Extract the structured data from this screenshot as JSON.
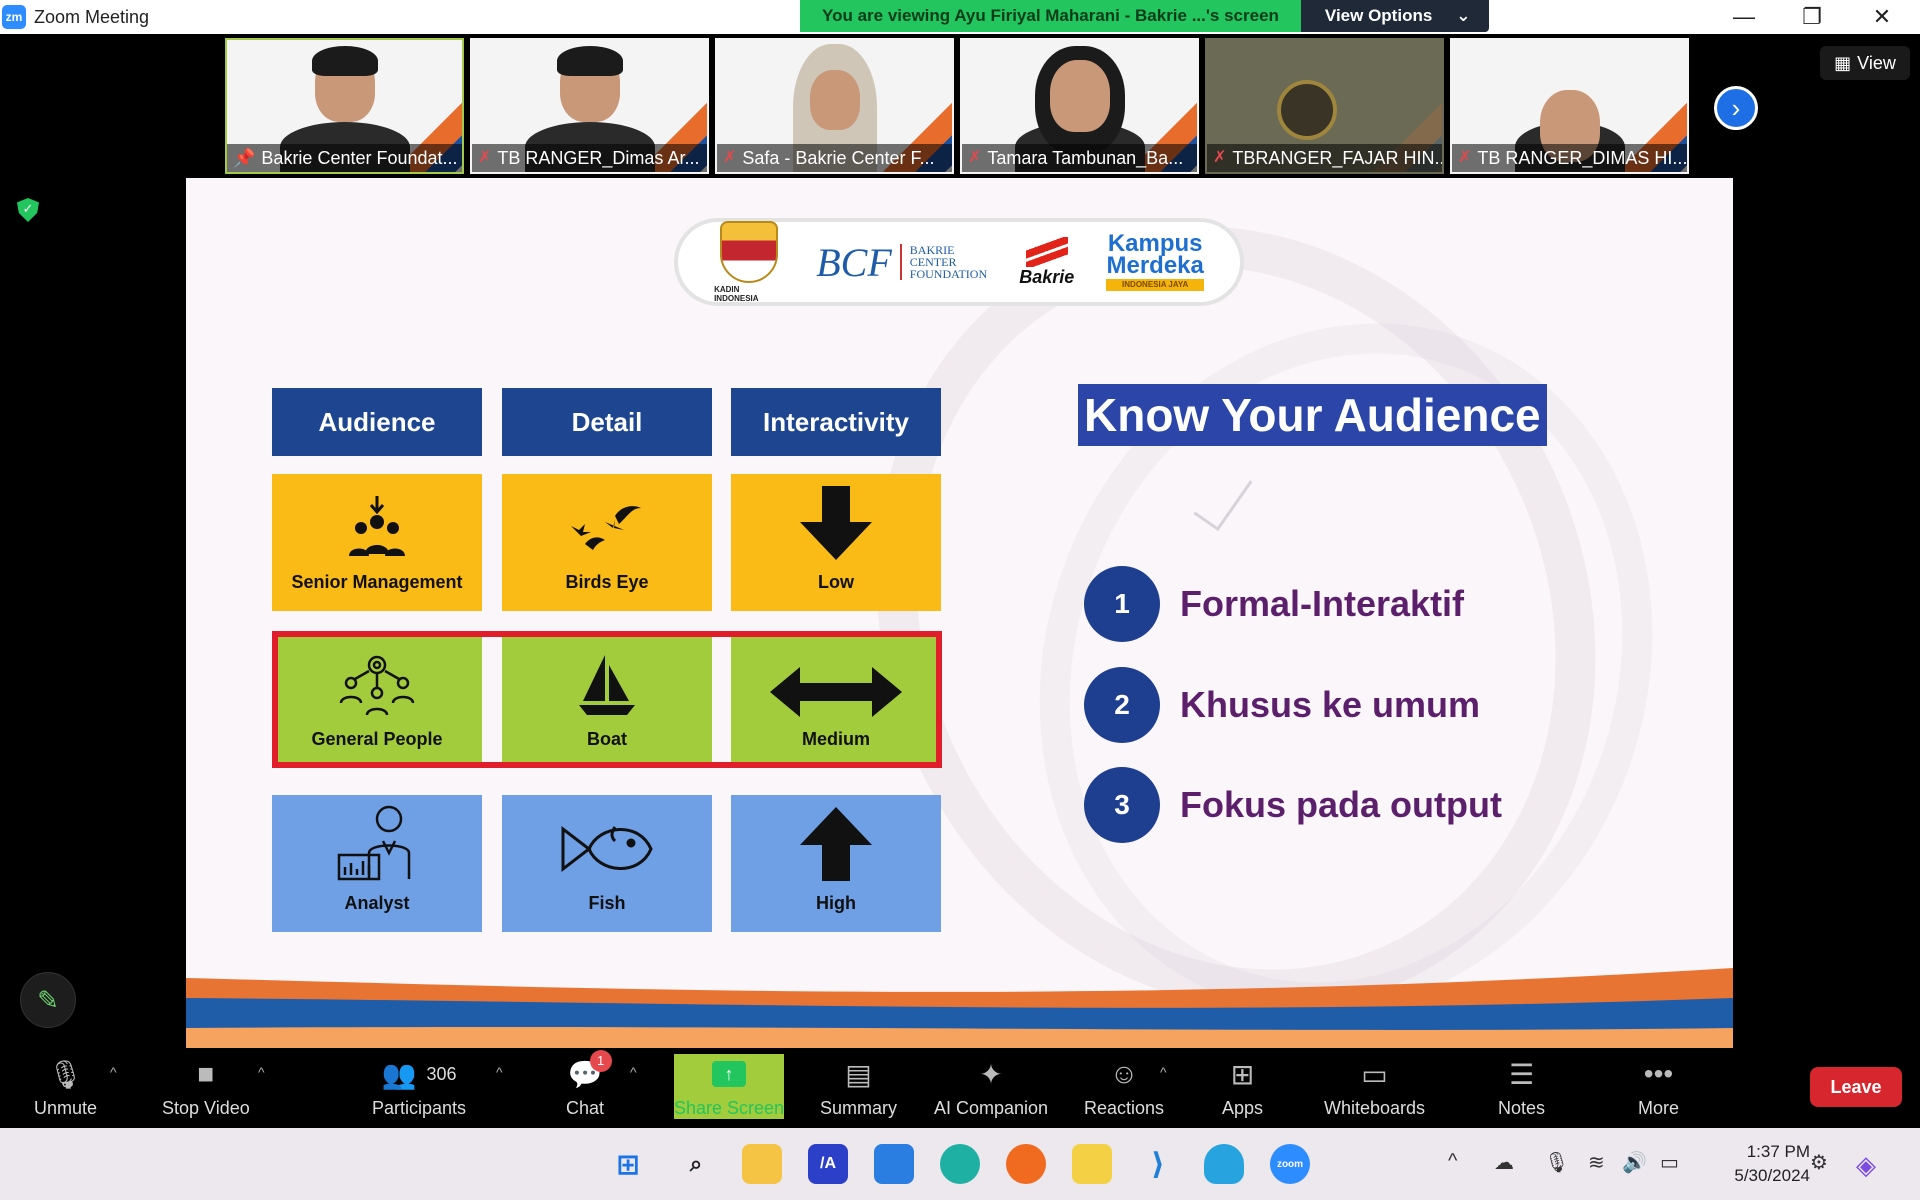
{
  "window": {
    "logo": "zm",
    "title": "Zoom Meeting",
    "minimize_icon": "minimize-icon",
    "restore_icon": "restore-icon",
    "close_icon": "close-icon"
  },
  "share_banner": {
    "message": "You are viewing Ayu Firiyal Maharani - Bakrie ...'s screen",
    "view_options": "View Options"
  },
  "participants_strip": [
    {
      "name": "Bakrie Center Foundat...",
      "muted": false
    },
    {
      "name": "TB RANGER_Dimas Ar...",
      "muted": true
    },
    {
      "name": "Safa - Bakrie Center F...",
      "muted": true
    },
    {
      "name": "Tamara Tambunan_Ba...",
      "muted": true
    },
    {
      "name": "TBRANGER_FAJAR HIN...",
      "muted": true
    },
    {
      "name": "TB RANGER_DIMAS HI...",
      "muted": true
    }
  ],
  "view_button": "View",
  "slide": {
    "logos": {
      "kadin": "KADIN INDONESIA",
      "bcf_mono": "BCF",
      "bcf_text": [
        "BAKRIE",
        "CENTER",
        "FOUNDATION"
      ],
      "bakrie": "Bakrie",
      "kampus_merdeka": [
        "Kampus",
        "Merdeka"
      ],
      "kampus_merdeka_sub": "INDONESIA JAYA"
    },
    "headers": [
      "Audience",
      "Detail",
      "Interactivity"
    ],
    "rows": [
      {
        "color": "#fbbb16",
        "cells": [
          {
            "label": "Senior Management",
            "icon": "senior-management-icon"
          },
          {
            "label": "Birds Eye",
            "icon": "birds-icon"
          },
          {
            "label": "Low",
            "icon": "arrow-down-icon"
          }
        ]
      },
      {
        "color": "#a3cc3c",
        "cells": [
          {
            "label": "General People",
            "icon": "general-people-icon"
          },
          {
            "label": "Boat",
            "icon": "boat-icon"
          },
          {
            "label": "Medium",
            "icon": "arrow-left-right-icon"
          }
        ]
      },
      {
        "color": "#6f9fe4",
        "cells": [
          {
            "label": "Analyst",
            "icon": "analyst-icon"
          },
          {
            "label": "Fish",
            "icon": "fish-icon"
          },
          {
            "label": "High",
            "icon": "arrow-up-icon"
          }
        ]
      }
    ],
    "title": "Know Your Audience",
    "points": [
      {
        "num": "1",
        "text": "Formal-Interaktif"
      },
      {
        "num": "2",
        "text": "Khusus ke umum"
      },
      {
        "num": "3",
        "text": "Fokus pada output"
      }
    ]
  },
  "toolbar": {
    "unmute": "Unmute",
    "stop_video": "Stop Video",
    "participants": "Participants",
    "participants_count": "306",
    "chat": "Chat",
    "chat_badge": "1",
    "share_screen": "Share Screen",
    "summary": "Summary",
    "ai_companion": "AI Companion",
    "reactions": "Reactions",
    "apps": "Apps",
    "whiteboards": "Whiteboards",
    "notes": "Notes",
    "more": "More",
    "leave": "Leave"
  },
  "taskbar": {
    "time": "1:37 PM",
    "date": "5/30/2024"
  },
  "colors": {
    "share_banner": "#22c55e",
    "header_blue": "#1e4690",
    "title_bg": "#2b45a8",
    "point_text": "#5b1f6b",
    "highlight_frame": "#e11d2c",
    "leave": "#d7262e"
  }
}
